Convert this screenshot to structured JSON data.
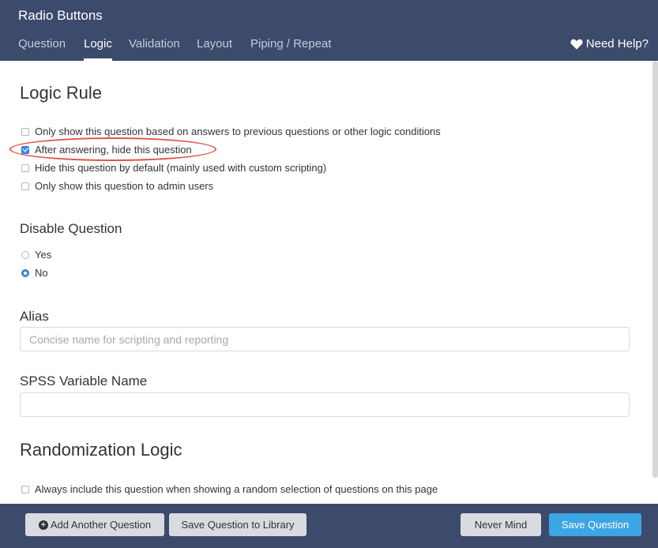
{
  "header": {
    "title": "Radio Buttons",
    "tabs": [
      {
        "label": "Question",
        "active": false
      },
      {
        "label": "Logic",
        "active": true
      },
      {
        "label": "Validation",
        "active": false
      },
      {
        "label": "Layout",
        "active": false
      },
      {
        "label": "Piping / Repeat",
        "active": false
      }
    ],
    "help_label": "Need Help?"
  },
  "logic_rule": {
    "heading": "Logic Rule",
    "options": [
      {
        "label": "Only show this question based on answers to previous questions or other logic conditions",
        "checked": false
      },
      {
        "label": "After answering, hide this question",
        "checked": true
      },
      {
        "label": "Hide this question by default (mainly used with custom scripting)",
        "checked": false
      },
      {
        "label": "Only show this question to admin users",
        "checked": false
      }
    ]
  },
  "disable_question": {
    "heading": "Disable Question",
    "options": [
      {
        "label": "Yes",
        "selected": false
      },
      {
        "label": "No",
        "selected": true
      }
    ]
  },
  "alias": {
    "heading": "Alias",
    "value": "",
    "placeholder": "Concise name for scripting and reporting"
  },
  "spss": {
    "heading": "SPSS Variable Name",
    "value": ""
  },
  "randomization": {
    "heading": "Randomization Logic",
    "options": [
      {
        "label": "Always include this question when showing a random selection of questions on this page",
        "checked": false
      }
    ]
  },
  "footer": {
    "add_another": "Add Another Question",
    "save_library": "Save Question to Library",
    "never_mind": "Never Mind",
    "save_question": "Save Question"
  },
  "colors": {
    "header_bg": "#3c4a6b",
    "accent": "#3ca5e4",
    "highlight": "#e2534a"
  }
}
